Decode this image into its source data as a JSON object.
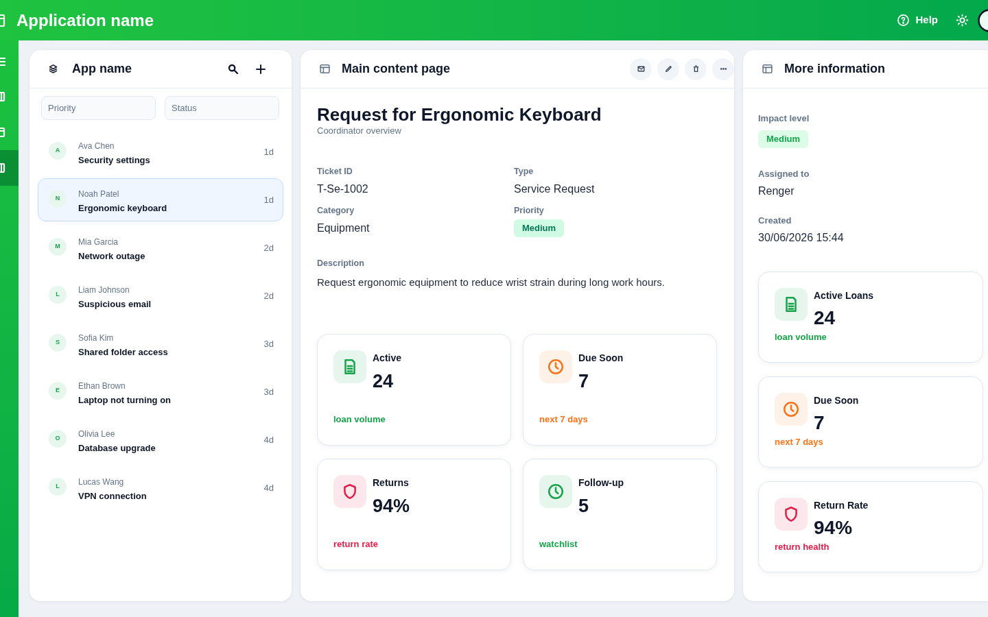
{
  "app": {
    "title": "Application name"
  },
  "top_bar": {
    "help_label": "Help"
  },
  "nav_rail": {
    "items": [
      {
        "selected": false
      },
      {
        "selected": false
      },
      {
        "selected": true
      }
    ]
  },
  "list_panel": {
    "title": "App name",
    "filters": [
      {
        "placeholder": "Priority"
      },
      {
        "placeholder": "Status"
      }
    ],
    "items": [
      {
        "initial": "A",
        "name": "Ava Chen",
        "title": "Security settings",
        "age": "1d",
        "selected": false
      },
      {
        "initial": "N",
        "name": "Noah Patel",
        "title": "Ergonomic keyboard",
        "age": "1d",
        "selected": true
      },
      {
        "initial": "M",
        "name": "Mia Garcia",
        "title": "Network outage",
        "age": "2d",
        "selected": false
      },
      {
        "initial": "L",
        "name": "Liam Johnson",
        "title": "Suspicious email",
        "age": "2d",
        "selected": false
      },
      {
        "initial": "S",
        "name": "Sofia Kim",
        "title": "Shared folder access",
        "age": "3d",
        "selected": false
      },
      {
        "initial": "E",
        "name": "Ethan Brown",
        "title": "Laptop not turning on",
        "age": "3d",
        "selected": false
      },
      {
        "initial": "O",
        "name": "Olivia Lee",
        "title": "Database upgrade",
        "age": "4d",
        "selected": false
      },
      {
        "initial": "L",
        "name": "Lucas Wang",
        "title": "VPN connection",
        "age": "4d",
        "selected": false
      }
    ]
  },
  "main_panel": {
    "title": "Main content page",
    "heading": "Request for Ergonomic Keyboard",
    "subheading": "Coordinator overview",
    "fields": [
      {
        "label": "Ticket ID",
        "value": "T-Se-1002",
        "kind": "text"
      },
      {
        "label": "Type",
        "value": "Service Request",
        "kind": "text"
      },
      {
        "label": "Category",
        "value": "Equipment",
        "kind": "text"
      },
      {
        "label": "Priority",
        "value": "Medium",
        "kind": "badge"
      }
    ],
    "description": {
      "label": "Description",
      "text": "Request ergonomic equipment to reduce wrist strain during long work hours."
    },
    "stats": [
      {
        "kind": "volume",
        "title": "Active",
        "value": "24",
        "caption": "loan volume",
        "color": "#16a34a"
      },
      {
        "kind": "due",
        "title": "Due Soon",
        "value": "7",
        "caption": "next 7 days",
        "color": "#f97316"
      },
      {
        "kind": "rate",
        "title": "Returns",
        "value": "94%",
        "caption": "return rate",
        "color": "#e11d48"
      },
      {
        "kind": "watch",
        "title": "Follow-up",
        "value": "5",
        "caption": "watchlist",
        "color": "#16a34a"
      }
    ]
  },
  "info_panel": {
    "title": "More information",
    "fields": [
      {
        "label": "Impact level",
        "value": "Medium",
        "kind": "badge"
      },
      {
        "label": "Assigned to",
        "value": "Renger",
        "kind": "text"
      },
      {
        "label": "Created",
        "value": "30/06/2026 15:44",
        "kind": "text"
      }
    ],
    "stats": [
      {
        "kind": "volume",
        "title": "Active Loans",
        "value": "24",
        "caption": "loan volume",
        "color": "#16a34a"
      },
      {
        "kind": "due",
        "title": "Due Soon",
        "value": "7",
        "caption": "next 7 days",
        "color": "#f97316"
      },
      {
        "kind": "rate",
        "title": "Return Rate",
        "value": "94%",
        "caption": "return health",
        "color": "#e11d48"
      }
    ]
  }
}
